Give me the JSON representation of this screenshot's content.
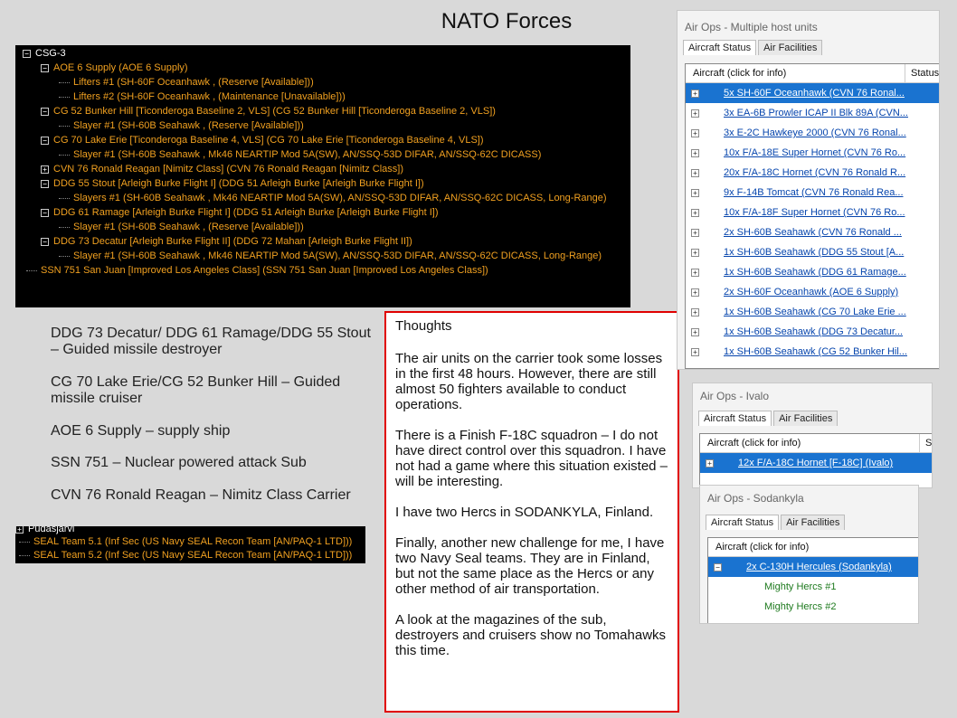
{
  "title": "NATO Forces",
  "tree": [
    {
      "text": "CSG-3",
      "level": 0,
      "box": "−",
      "white": true
    },
    {
      "text": "AOE 6 Supply (AOE 6 Supply)",
      "level": 1,
      "box": "−"
    },
    {
      "text": "Lifters #1 (SH-60F Oceanhawk , (Reserve [Available]))",
      "level": 2
    },
    {
      "text": "Lifters #2 (SH-60F Oceanhawk , (Maintenance [Unavailable]))",
      "level": 2
    },
    {
      "text": "CG 52 Bunker Hill [Ticonderoga Baseline 2, VLS] (CG 52 Bunker Hill [Ticonderoga Baseline 2, VLS])",
      "level": 1,
      "box": "−"
    },
    {
      "text": "Slayer #1 (SH-60B Seahawk , (Reserve [Available]))",
      "level": 2
    },
    {
      "text": "CG 70 Lake Erie [Ticonderoga Baseline 4, VLS] (CG 70 Lake Erie [Ticonderoga Baseline 4, VLS])",
      "level": 1,
      "box": "−"
    },
    {
      "text": "Slayer #1 (SH-60B Seahawk , Mk46 NEARTIP Mod 5A(SW), AN/SSQ-53D DIFAR, AN/SSQ-62C DICASS)",
      "level": 2
    },
    {
      "text": "CVN 76 Ronald Reagan [Nimitz Class] (CVN 76 Ronald Reagan [Nimitz Class])",
      "level": 1,
      "box": "+"
    },
    {
      "text": "DDG 55 Stout [Arleigh Burke Flight I] (DDG 51 Arleigh Burke [Arleigh Burke Flight I])",
      "level": 1,
      "box": "−"
    },
    {
      "text": "Slayers #1 (SH-60B Seahawk , Mk46 NEARTIP Mod 5A(SW), AN/SSQ-53D DIFAR, AN/SSQ-62C DICASS, Long-Range)",
      "level": 2
    },
    {
      "text": "DDG 61 Ramage [Arleigh Burke Flight I] (DDG 51 Arleigh Burke [Arleigh Burke Flight I])",
      "level": 1,
      "box": "−"
    },
    {
      "text": "Slayer #1 (SH-60B Seahawk , (Reserve [Available]))",
      "level": 2
    },
    {
      "text": "DDG 73 Decatur [Arleigh Burke Flight II] (DDG 72 Mahan [Arleigh Burke Flight II])",
      "level": 1,
      "box": "−"
    },
    {
      "text": "Slayer #1 (SH-60B Seahawk , Mk46 NEARTIP Mod 5A(SW), AN/SSQ-53D DIFAR, AN/SSQ-62C DICASS, Long-Range)",
      "level": 2
    },
    {
      "text": "SSN 751 San Juan [Improved Los Angeles Class] (SSN 751 San Juan [Improved Los Angeles Class])",
      "level": 0.5
    }
  ],
  "descriptions": [
    "DDG 73 Decatur/ DDG 61 Ramage/DDG 55 Stout – Guided missile destroyer",
    "CG 70 Lake Erie/CG 52 Bunker Hill – Guided missile cruiser",
    "AOE 6 Supply – supply ship",
    "SSN 751 – Nuclear powered attack Sub",
    "CVN 76 Ronald Reagan – Nimitz Class Carrier"
  ],
  "seal": {
    "header": "Pudasjarvi",
    "items": [
      "SEAL Team 5.1 (Inf Sec (US Navy SEAL Recon Team [AN/PAQ-1 LTD]))",
      "SEAL Team 5.2 (Inf Sec (US Navy SEAL Recon Team [AN/PAQ-1 LTD]))"
    ]
  },
  "thoughts": [
    "Thoughts",
    "The air units on the carrier took some losses in the first 48 hours.  However, there are still almost 50 fighters available to conduct operations.",
    "There is a Finish F-18C squadron – I do not have direct control over this squadron.  I have not had a game where this situation existed – will be interesting.",
    "I have two Hercs in SODANKYLA, Finland.",
    "Finally, another new challenge for me, I have two Navy Seal teams.  They are in Finland, but not the same place as the Hercs or any other method of air transportation.",
    "A look at the magazines of the sub, destroyers and cruisers show no Tomahawks this time."
  ],
  "airops_main": {
    "title": "Air Ops - Multiple host units",
    "tab_status": "Aircraft Status",
    "tab_facilities": "Air Facilities",
    "col_aircraft": "Aircraft (click for info)",
    "col_status": "Status",
    "rows": [
      "5x SH-60F Oceanhawk (CVN 76 Ronal...",
      "3x EA-6B Prowler ICAP II Blk 89A (CVN...",
      "3x E-2C Hawkeye 2000 (CVN 76 Ronal...",
      "10x F/A-18E Super Hornet (CVN 76 Ro...",
      "20x F/A-18C Hornet (CVN 76 Ronald R...",
      "9x F-14B Tomcat (CVN 76 Ronald Rea...",
      "10x F/A-18F Super Hornet (CVN 76 Ro...",
      "2x SH-60B Seahawk (CVN 76 Ronald ...",
      "1x SH-60B Seahawk (DDG 55 Stout [A...",
      "1x SH-60B Seahawk (DDG 61 Ramage...",
      "2x SH-60F Oceanhawk (AOE 6 Supply)",
      "1x SH-60B Seahawk (CG 70 Lake Erie ...",
      "1x SH-60B Seahawk (DDG 73 Decatur...",
      "1x SH-60B Seahawk (CG 52 Bunker Hil..."
    ]
  },
  "airops_ivalo": {
    "title": "Air Ops - Ivalo",
    "tab_status": "Aircraft Status",
    "tab_facilities": "Air Facilities",
    "col_aircraft": "Aircraft (click for info)",
    "col_status": "S",
    "row": "12x F/A-18C Hornet [F-18C] (Ivalo)"
  },
  "airops_sodankyla": {
    "title": "Air Ops - Sodankyla",
    "tab_status": "Aircraft Status",
    "tab_facilities": "Air Facilities",
    "col_aircraft": "Aircraft (click for info)",
    "row": "2x C-130H Hercules (Sodankyla)",
    "sub_rows": [
      "Mighty Hercs #1",
      "Mighty Hercs #2"
    ]
  }
}
